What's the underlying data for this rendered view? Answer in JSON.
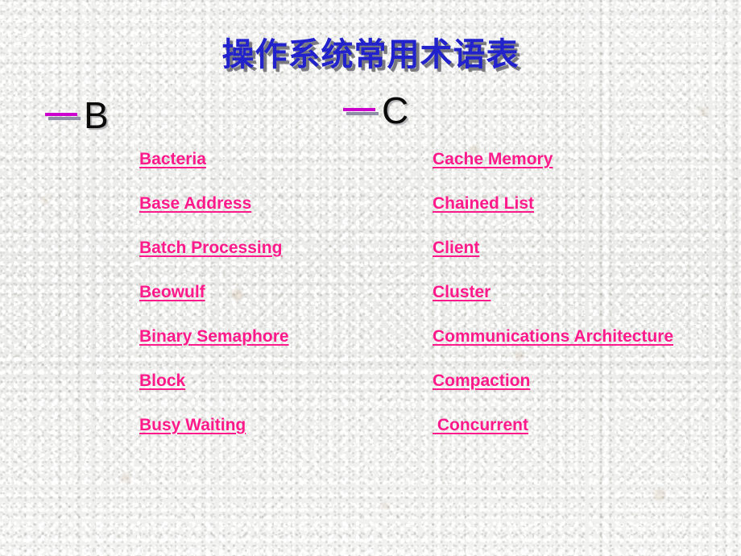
{
  "slide": {
    "title": "操作系统常用术语表",
    "title_color": "#2222cc",
    "link_color": "#ff1a8c",
    "dash_color": "#cc00cc",
    "dash_shadow_color": "#8e8ea6",
    "background_color": "#ececeb"
  },
  "sections": [
    {
      "letter": "B",
      "terms": [
        "Bacteria",
        "Base Address",
        "Batch Processing",
        "Beowulf",
        "Binary Semaphore",
        "Block",
        "Busy Waiting"
      ]
    },
    {
      "letter": "C",
      "terms": [
        "Cache Memory",
        "Chained List",
        "Client",
        "Cluster",
        "Communications Architecture",
        "Compaction",
        " Concurrent"
      ]
    }
  ]
}
